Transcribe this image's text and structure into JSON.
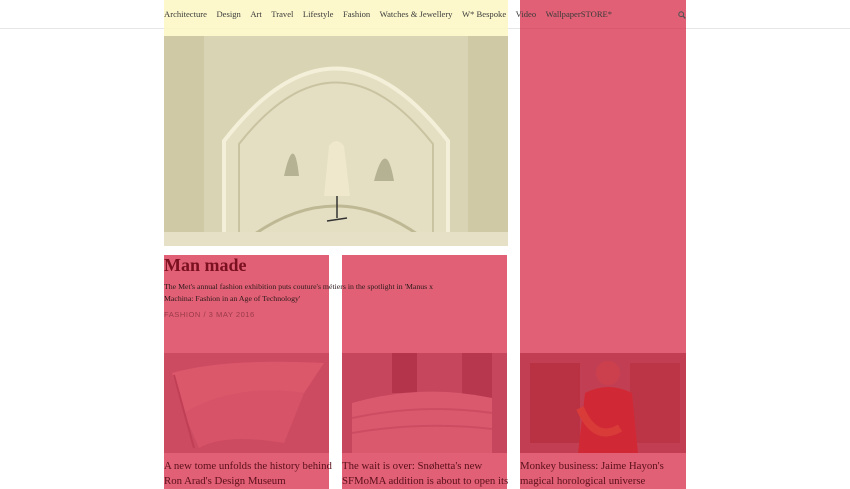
{
  "nav": {
    "items": [
      "Architecture",
      "Design",
      "Art",
      "Travel",
      "Lifestyle",
      "Fashion",
      "Watches & Jewellery",
      "W* Bespoke",
      "Video",
      "WallpaperSTORE*"
    ],
    "search_icon": "search-icon"
  },
  "hero": {
    "title": "Man made",
    "subtitle": "The Met's annual fashion exhibition puts couture's métiers in the spotlight in 'Manus x Machina: Fashion in an Age of Technology'",
    "meta": "FASHION / 3 MAY 2016"
  },
  "cards": [
    {
      "title": "A new tome unfolds the history behind Ron Arad's Design Museum"
    },
    {
      "title": "The wait is over: Snøhetta's new SFMoMA addition is about to open its"
    },
    {
      "title": "Monkey business: Jaime Hayon's magical horological universe"
    }
  ],
  "colors": {
    "overlay_red": "#d62340",
    "nav_highlight": "#fbf7c3"
  }
}
